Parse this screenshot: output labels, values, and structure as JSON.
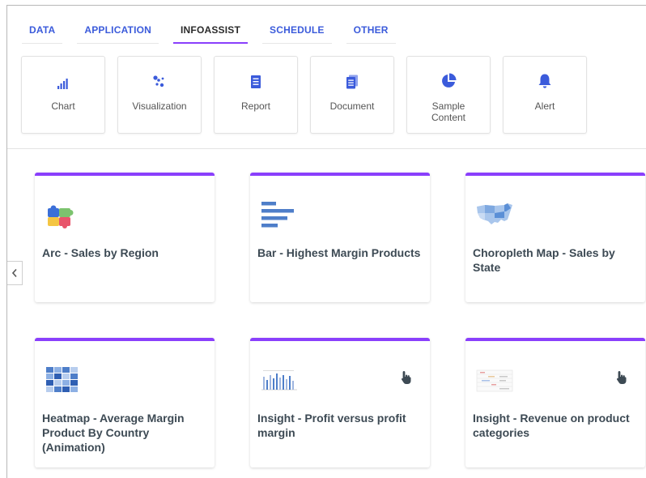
{
  "tabs": [
    {
      "label": "DATA",
      "active": false
    },
    {
      "label": "APPLICATION",
      "active": false
    },
    {
      "label": "INFOASSIST",
      "active": true
    },
    {
      "label": "SCHEDULE",
      "active": false
    },
    {
      "label": "OTHER",
      "active": false
    }
  ],
  "tiles": [
    {
      "label": "Chart",
      "icon": "bar-chart-icon"
    },
    {
      "label": "Visualization",
      "icon": "scatter-dots-icon"
    },
    {
      "label": "Report",
      "icon": "report-icon"
    },
    {
      "label": "Document",
      "icon": "document-icon"
    },
    {
      "label": "Sample Content",
      "icon": "pie-chart-icon"
    },
    {
      "label": "Alert",
      "icon": "bell-icon"
    }
  ],
  "cards": [
    {
      "title": "Arc - Sales by Region",
      "icon": "arc-puzzle-icon",
      "interactive": false
    },
    {
      "title": "Bar - Highest Margin Products",
      "icon": "horizontal-bar-icon",
      "interactive": false
    },
    {
      "title": "Choropleth Map - Sales by State",
      "icon": "us-map-icon",
      "interactive": false
    },
    {
      "title": "Heatmap - Average Margin Product By Country (Animation)",
      "icon": "heatmap-icon",
      "interactive": false
    },
    {
      "title": "Insight - Profit versus profit margin",
      "icon": "insight-chart-icon",
      "interactive": true
    },
    {
      "title": "Insight - Revenue on product categories",
      "icon": "insight-table-icon",
      "interactive": true
    }
  ],
  "colors": {
    "accent": "#8a3ffc",
    "tab_text": "#3b5bdb",
    "icon_blue": "#3b5bdb",
    "card_title": "#3d4a54"
  }
}
